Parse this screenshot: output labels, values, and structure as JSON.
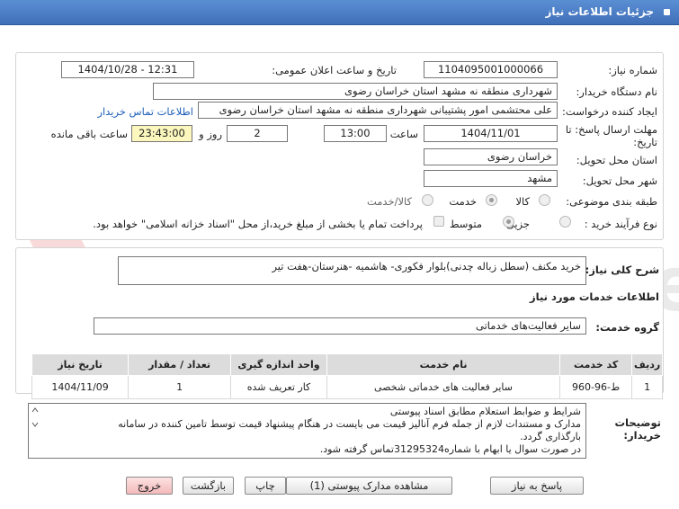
{
  "header": {
    "title": "جزئیات اطلاعات نیاز"
  },
  "info": {
    "need_number_label": "شماره نیاز:",
    "need_number": "1104095001000066",
    "announce_label": "تاریخ و ساعت اعلان عمومی:",
    "announce_value": "1404/10/28 - 12:31",
    "buyer_label": "نام دستگاه خریدار:",
    "buyer_value": "شهرداری منطقه نه مشهد استان خراسان رضوی",
    "creator_label": "ایجاد کننده درخواست:",
    "creator_value": "علی محتشمی امور پشتیبانی شهرداری منطقه نه مشهد استان خراسان رضوی",
    "contact_link": "اطلاعات تماس خریدار",
    "deadline_label_1": "مهلت ارسال پاسخ: تا",
    "deadline_label_2": "تاریخ:",
    "deadline_date": "1404/11/01",
    "time_label": "ساعت",
    "deadline_time": "13:00",
    "days_value": "2",
    "days_label": "روز و",
    "remaining_time": "23:43:00",
    "remaining_label": "ساعت باقی مانده",
    "province_label": "استان محل تحویل:",
    "province_value": "خراسان رضوی",
    "city_label": "شهر محل تحویل:",
    "city_value": "مشهد",
    "category_label": "طبقه بندی موضوعی:",
    "category_options": [
      "کالا",
      "خدمت",
      "کالا/خدمت"
    ],
    "category_selected": "خدمت",
    "process_label": "نوع فرآیند خرید :",
    "process_options": [
      "جزیی",
      "متوسط"
    ],
    "process_selected": "متوسط",
    "payment_note": "پرداخت تمام یا بخشی از مبلغ خرید،از محل \"اسناد خزانه اسلامی\" خواهد بود."
  },
  "summary": {
    "label": "شرح کلی نیاز:",
    "value": "خرید مکنف (سطل زباله چدنی)بلوار فکوری- هاشمیه -هنرستان-هفت تیر",
    "services_heading": "اطلاعات خدمات مورد نیاز",
    "group_label": "گروه خدمت:",
    "group_value": "سایر فعالیت‌های خدماتی"
  },
  "table": {
    "columns": [
      "ردیف",
      "کد خدمت",
      "نام خدمت",
      "واحد اندازه گیری",
      "تعداد / مقدار",
      "تاریخ نیاز"
    ],
    "rows": [
      [
        "1",
        "ط-96-960",
        "سایر فعالیت های خدماتی شخصی",
        "کار تعریف شده",
        "1",
        "1404/11/09"
      ]
    ]
  },
  "notes": {
    "label_1": "توضیحات",
    "label_2": "خریدار:",
    "line_1": "شرایط و ضوابط استعلام مطابق اسناد پیوستی",
    "line_2": "مدارک و مستندات لازم از جمله فرم آنالیز قیمت می بایست در هنگام پیشنهاد قیمت توسط تامین کننده در سامانه",
    "line_3": "بارگذاری گردد.",
    "line_4": "در صورت سوال یا ابهام با شماره31295324تماس گرفته شود."
  },
  "buttons": {
    "reply": "پاسخ به نیاز",
    "attachments": "مشاهده مدارک پیوستی (1)",
    "print": "چاپ",
    "back": "بازگشت",
    "exit": "خروج"
  },
  "watermark": {
    "text": "AriaTender.net"
  },
  "colors": {
    "title_bar": "#4a7fc7",
    "remaining_bg": "#fbf7bd",
    "link": "#1d5fb8",
    "exit_bg": "#f3b9b9"
  }
}
